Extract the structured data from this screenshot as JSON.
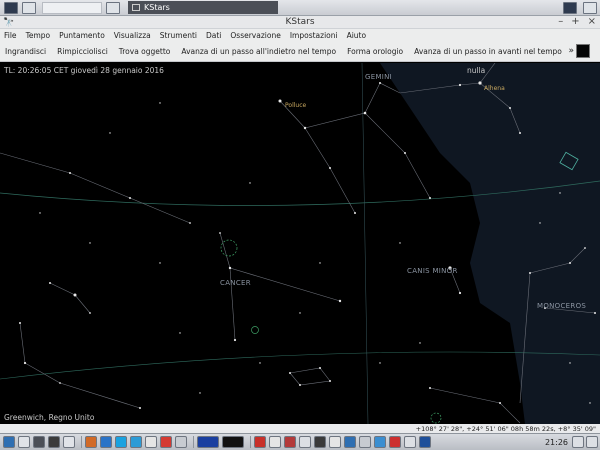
{
  "top_panel": {
    "task_title": "KStars"
  },
  "titlebar": {
    "title": "KStars",
    "buttons": [
      "–",
      "+",
      "×"
    ]
  },
  "menubar": {
    "items": [
      "File",
      "Tempo",
      "Puntamento",
      "Visualizza",
      "Strumenti",
      "Dati",
      "Osservazione",
      "Impostazioni",
      "Aiuto"
    ]
  },
  "toolbar": {
    "items": [
      "Ingrandisci",
      "Rimpicciolisci",
      "Trova oggetto",
      "Avanza di un passo all'indietro nel tempo",
      "Forma orologio",
      "Avanza di un passo in avanti nel tempo"
    ],
    "more": "»"
  },
  "sky": {
    "time_readout": "TL: 20:26:05 CET   giovedì 28 gennaio 2016",
    "focus_readout": "nulla",
    "location": "Greenwich, Regno Unito",
    "constellations": [
      "GEMINI",
      "CANCER",
      "CANIS MINOR",
      "MONOCEROS"
    ],
    "stars": [
      "Polluce",
      "Alhena"
    ]
  },
  "statusbar": {
    "coords": "+108° 27' 28\", +24° 51' 06\"  08h 58m 22s, +8° 35' 09\""
  },
  "bottom_panel": {
    "clock": "21:26"
  },
  "colors": {
    "sky": "#000000",
    "milky_way": "#0f1722",
    "constellation_lines": "#6b6f78",
    "ecliptic": "#2f6b5e",
    "label": "#8a93a0"
  }
}
